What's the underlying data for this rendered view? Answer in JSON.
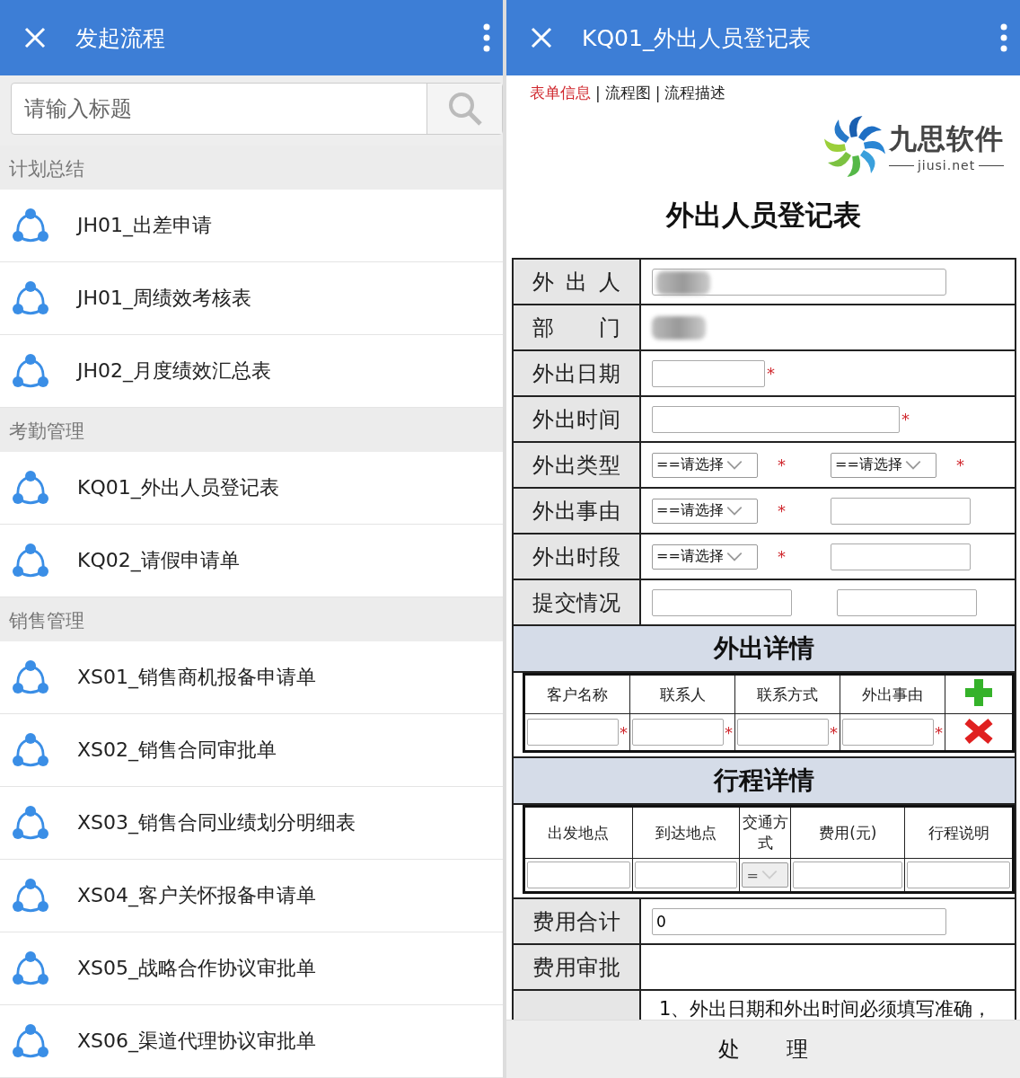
{
  "left": {
    "header": {
      "title": "发起流程"
    },
    "search": {
      "placeholder": "请输入标题"
    },
    "groups": [
      {
        "title": "计划总结",
        "items": [
          {
            "label": "JH01_出差申请"
          },
          {
            "label": "JH01_周绩效考核表"
          },
          {
            "label": "JH02_月度绩效汇总表"
          }
        ]
      },
      {
        "title": "考勤管理",
        "items": [
          {
            "label": "KQ01_外出人员登记表"
          },
          {
            "label": "KQ02_请假申请单"
          }
        ]
      },
      {
        "title": "销售管理",
        "items": [
          {
            "label": "XS01_销售商机报备申请单"
          },
          {
            "label": "XS02_销售合同审批单"
          },
          {
            "label": "XS03_销售合同业绩划分明细表"
          },
          {
            "label": "XS04_客户关怀报备申请单"
          },
          {
            "label": "XS05_战略合作协议审批单"
          },
          {
            "label": "XS06_渠道代理协议审批单"
          }
        ]
      }
    ]
  },
  "right": {
    "header": {
      "title": "KQ01_外出人员登记表"
    },
    "required_mark": "*",
    "tab_separator": "|",
    "tabs": [
      {
        "label": "表单信息",
        "selected": true
      },
      {
        "label": "流程图",
        "selected": false
      },
      {
        "label": "流程描述",
        "selected": false
      }
    ],
    "logo": {
      "name": "九思软件",
      "sub": "jiusi.net"
    },
    "form_title": "外出人员登记表",
    "fields": [
      {
        "label": "外出人",
        "controls": [
          {
            "kind": "blurred_input"
          }
        ]
      },
      {
        "label": "部门",
        "controls": [
          {
            "kind": "blurred"
          }
        ]
      },
      {
        "label": "外出日期",
        "controls": [
          {
            "kind": "date",
            "required": true
          }
        ]
      },
      {
        "label": "外出时间",
        "controls": [
          {
            "kind": "datetime",
            "required": true
          }
        ]
      },
      {
        "label": "外出类型",
        "controls": [
          {
            "kind": "select",
            "value": "==请选择",
            "required": true
          },
          {
            "kind": "select",
            "value": "==请选择",
            "required": true
          }
        ]
      },
      {
        "label": "外出事由",
        "controls": [
          {
            "kind": "select",
            "value": "==请选择",
            "required": true
          },
          {
            "kind": "box"
          }
        ]
      },
      {
        "label": "外出时段",
        "controls": [
          {
            "kind": "select",
            "value": "==请选择",
            "required": true
          },
          {
            "kind": "box"
          }
        ]
      },
      {
        "label": "提交情况",
        "controls": [
          {
            "kind": "box"
          },
          {
            "kind": "box"
          }
        ]
      }
    ],
    "outing_details": {
      "title": "外出详情",
      "columns": [
        "客户名称",
        "联系人",
        "联系方式",
        "外出事由"
      ],
      "row": [
        {
          "kind": "input",
          "required": true
        },
        {
          "kind": "input",
          "required": true
        },
        {
          "kind": "input",
          "required": true
        },
        {
          "kind": "input",
          "required": true
        }
      ]
    },
    "trip_details": {
      "title": "行程详情",
      "columns": [
        "出发地点",
        "到达地点",
        "交通方式",
        "费用(元)",
        "行程说明"
      ],
      "row": [
        {
          "kind": "input"
        },
        {
          "kind": "input"
        },
        {
          "kind": "select",
          "value": "=",
          "disabled": true
        },
        {
          "kind": "input"
        },
        {
          "kind": "input"
        }
      ]
    },
    "totals": [
      {
        "label": "费用合计",
        "value": "0",
        "kind": "input"
      },
      {
        "label": "费用审批",
        "kind": "empty"
      },
      {
        "kind": "note",
        "note": "1、外出日期和外出时间必须填写准确，"
      }
    ],
    "action_button": "处 理"
  }
}
